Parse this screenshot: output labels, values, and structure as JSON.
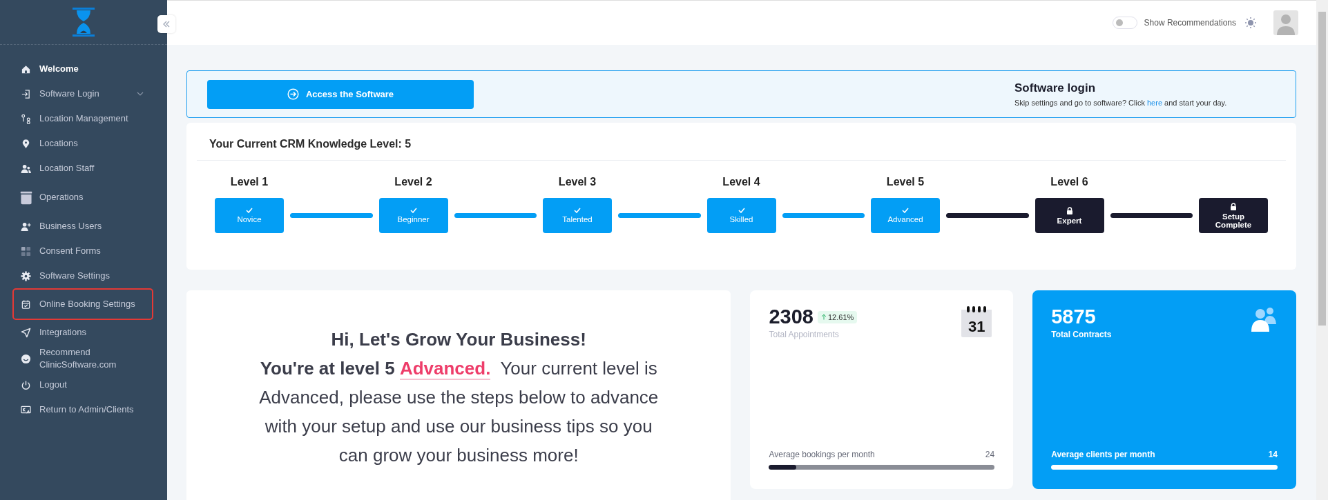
{
  "sidebar": {
    "items": [
      {
        "label": "Welcome",
        "kind": "link",
        "active": true,
        "highlighted": false
      },
      {
        "label": "Software Login",
        "kind": "dropdown",
        "active": false,
        "highlighted": false
      },
      {
        "label": "Location Management",
        "kind": "link",
        "active": false,
        "highlighted": false
      },
      {
        "label": "Locations",
        "kind": "link",
        "active": false,
        "highlighted": false
      },
      {
        "label": "Location Staff",
        "kind": "link",
        "active": false,
        "highlighted": false
      },
      {
        "label": "Operations",
        "kind": "link",
        "active": false,
        "highlighted": false
      },
      {
        "label": "Business Users",
        "kind": "link",
        "active": false,
        "highlighted": false
      },
      {
        "label": "Consent Forms",
        "kind": "link",
        "active": false,
        "highlighted": false
      },
      {
        "label": "Software Settings",
        "kind": "link",
        "active": false,
        "highlighted": false
      },
      {
        "label": "Online Booking Settings",
        "kind": "link",
        "active": false,
        "highlighted": true
      },
      {
        "label": "Integrations",
        "kind": "link",
        "active": false,
        "highlighted": false
      },
      {
        "label": "Recommend ClinicSoftware.com",
        "kind": "link",
        "active": false,
        "highlighted": false
      },
      {
        "label": "Logout",
        "kind": "link",
        "active": false,
        "highlighted": false
      },
      {
        "label": "Return to Admin/Clients",
        "kind": "link",
        "active": false,
        "highlighted": false
      }
    ]
  },
  "topbar": {
    "recommendations_toggle": {
      "label": "Show Recommendations",
      "on": false
    }
  },
  "banner": {
    "button": "Access the Software",
    "title": "Software login",
    "text_before": "Skip settings and go to software? Click",
    "link": "here",
    "text_after": "and start your day."
  },
  "knowledge": {
    "title": "Your Current CRM Knowledge Level: 5",
    "steps": [
      {
        "level": "Level 1",
        "name": "Novice",
        "completed": true
      },
      {
        "level": "Level 2",
        "name": "Beginner",
        "completed": true
      },
      {
        "level": "Level 3",
        "name": "Talented",
        "completed": true
      },
      {
        "level": "Level 4",
        "name": "Skilled",
        "completed": true
      },
      {
        "level": "Level 5",
        "name": "Advanced",
        "completed": true
      },
      {
        "level": "Level 6",
        "name": "Expert",
        "completed": false
      },
      {
        "name": "Setup Complete",
        "completed": false
      }
    ]
  },
  "welcome": {
    "heading": "Hi, Let's Grow Your Business!",
    "prefix": "**You're at level 5**",
    "level_name": "Advanced.",
    "rest": "Your current level is Advanced, please use the steps below to advance with your setup and use our business tips so you can grow your business more!"
  },
  "stats": [
    {
      "kind": "plain",
      "value": "2308",
      "change": "12.61%",
      "label": "Total Appointments",
      "calendar_day": "31",
      "footer_label": "Average bookings per month",
      "footer_value": "24",
      "level": 0.12
    },
    {
      "kind": "accent",
      "value": "5875",
      "label": "Total Contracts",
      "footer_label": "Average clients per month",
      "footer_value": "14",
      "level": 1
    }
  ]
}
